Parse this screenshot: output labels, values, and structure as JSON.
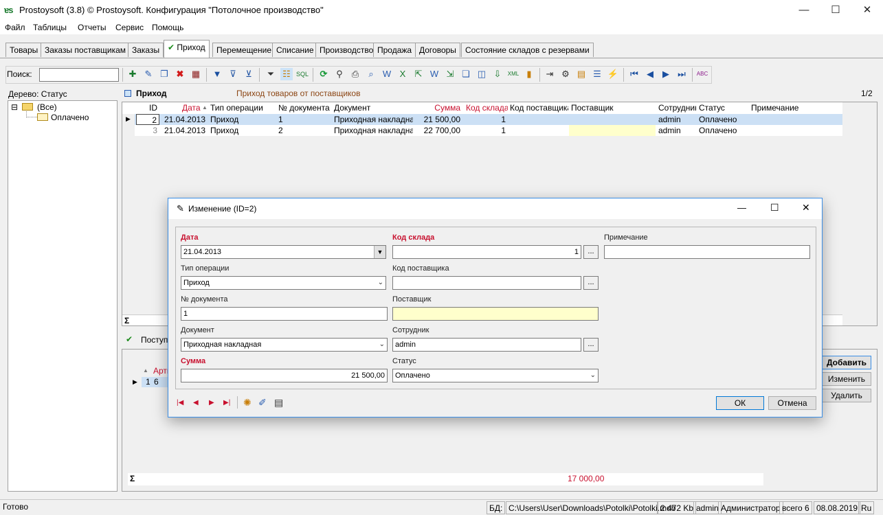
{
  "window": {
    "logo": "ɐs",
    "title": "Prostoysoft (3.8) © Prostoysoft. Конфигурация \"Потолочное производство\"",
    "minimize": "—",
    "maximize": "☐",
    "close": "✕"
  },
  "menu": [
    "Файл",
    "Таблицы",
    "Отчеты",
    "Сервис",
    "Помощь"
  ],
  "tabs": [
    "Товары",
    "Заказы поставщикам",
    "Заказы",
    "Приход",
    "Перемещение",
    "Списание",
    "Производство",
    "Продажа",
    "Договоры",
    "Состояние складов с резервами"
  ],
  "active_tab_check": "✔",
  "search": {
    "label": "Поиск:",
    "value": ""
  },
  "tree": {
    "label": "Дерево: Статус",
    "root": "(Все)",
    "child": "Оплачено",
    "expander": "⊟"
  },
  "grid": {
    "title": "Приход",
    "subtitle": "Приход товаров от поставщиков",
    "page": "1/2",
    "sum_symbol": "Σ",
    "columns": [
      "ID",
      "Дата",
      "Тип операции",
      "№ документа",
      "Документ",
      "Сумма",
      "Код склада",
      "Код поставщика",
      "Поставщик",
      "Сотрудник",
      "Статус",
      "Примечание"
    ],
    "sort_indicator": "▲",
    "rows": [
      [
        "2",
        "21.04.2013",
        "Приход",
        "1",
        "Приходная накладная",
        "21 500,00",
        "1",
        "",
        "",
        "admin",
        "Оплачено",
        ""
      ],
      [
        "3",
        "21.04.2013",
        "Приход",
        "2",
        "Приходная накладная",
        "22 700,00",
        "1",
        "",
        "",
        "admin",
        "Оплачено",
        ""
      ]
    ],
    "row_pointer": "▶"
  },
  "detail": {
    "title": "Поступи",
    "check": "✔",
    "col_sort": "▲",
    "col_label": "Арти",
    "row_cells": [
      "1",
      "6"
    ],
    "sum_symbol": "Σ",
    "total": "17 000,00",
    "buttons": [
      "Добавить",
      "Изменить",
      "Удалить"
    ]
  },
  "dialog": {
    "title_icon": "✎",
    "title": "Изменение (ID=2)",
    "minimize": "—",
    "maximize": "☐",
    "close": "✕",
    "fields": {
      "date": {
        "label": "Дата",
        "value": "21.04.2013"
      },
      "op_type": {
        "label": "Тип операции",
        "value": "Приход"
      },
      "doc_num": {
        "label": "№ документа",
        "value": "1"
      },
      "document": {
        "label": "Документ",
        "value": "Приходная накладная"
      },
      "sum": {
        "label": "Сумма",
        "value": "21 500,00"
      },
      "warehouse": {
        "label": "Код склада",
        "value": "1"
      },
      "supplier_code": {
        "label": "Код поставщика",
        "value": ""
      },
      "supplier": {
        "label": "Поставщик",
        "value": ""
      },
      "employee": {
        "label": "Сотрудник",
        "value": "admin"
      },
      "status": {
        "label": "Статус",
        "value": "Оплачено"
      },
      "note": {
        "label": "Примечание",
        "value": ""
      }
    },
    "ellipsis": "...",
    "nav": [
      "|◀",
      "◀",
      "▶",
      "▶|"
    ],
    "ok": "ОК",
    "cancel": "Отмена"
  },
  "status": {
    "left": "Готово",
    "db_label": "БД:",
    "db_path": "C:\\Users\\User\\Downloads\\Potolki\\Potolki.mdb",
    "size": "2 472 Kb",
    "user": "admin",
    "role": "Администратор",
    "count": "всего 6",
    "date": "08.08.2019",
    "lang": "Ru"
  },
  "colors": {
    "required_label": "#c8102e",
    "grid_selected_row": "#cce0f5",
    "supplier_highlight": "#ffffcc",
    "dialog_border": "#3a8ee6"
  }
}
